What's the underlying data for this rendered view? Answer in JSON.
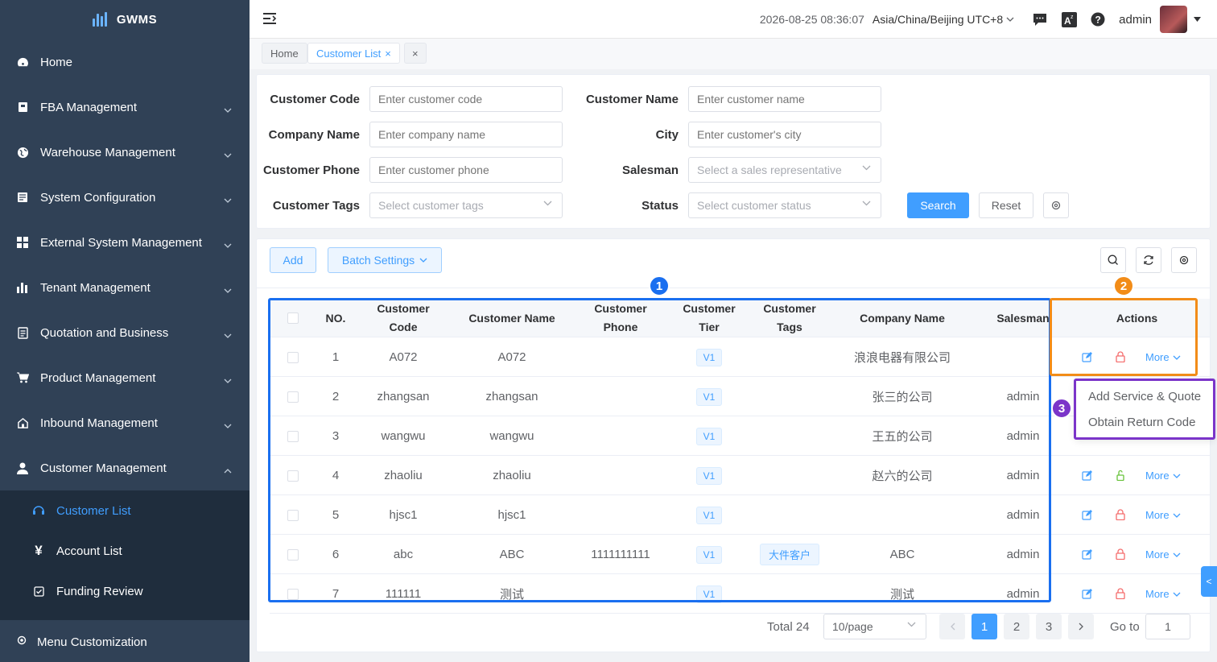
{
  "brand": {
    "name": "GWMS"
  },
  "sidebar": {
    "items": [
      {
        "label": "Home",
        "icon": "dashboard-icon"
      },
      {
        "label": "FBA Management",
        "icon": "box-icon"
      },
      {
        "label": "Warehouse Management",
        "icon": "globe-icon"
      },
      {
        "label": "System Configuration",
        "icon": "server-icon"
      },
      {
        "label": "External System Management",
        "icon": "grid-icon"
      },
      {
        "label": "Tenant Management",
        "icon": "bar-chart-icon"
      },
      {
        "label": "Quotation and Business",
        "icon": "document-icon"
      },
      {
        "label": "Product Management",
        "icon": "cart-icon"
      },
      {
        "label": "Inbound Management",
        "icon": "home-icon"
      },
      {
        "label": "Customer Management",
        "icon": "user-icon"
      }
    ],
    "sub_items": [
      {
        "label": "Customer List",
        "icon": "headset-icon",
        "active": true
      },
      {
        "label": "Account List",
        "icon": "yen-icon"
      },
      {
        "label": "Funding Review",
        "icon": "check-square-icon"
      }
    ],
    "menu_customization": "Menu Customization"
  },
  "header": {
    "datetime": "2026-08-25 08:36:07",
    "timezone": "Asia/China/Beijing UTC+8",
    "user": "admin"
  },
  "tabs": [
    {
      "label": "Home"
    },
    {
      "label": "Customer List",
      "close": "×"
    },
    {
      "label": "×"
    }
  ],
  "filters": {
    "customer_code": {
      "label": "Customer Code",
      "placeholder": "Enter customer code"
    },
    "customer_name": {
      "label": "Customer Name",
      "placeholder": "Enter customer name"
    },
    "company_name": {
      "label": "Company Name",
      "placeholder": "Enter company name"
    },
    "city": {
      "label": "City",
      "placeholder": "Enter customer's city"
    },
    "customer_phone": {
      "label": "Customer Phone",
      "placeholder": "Enter customer phone"
    },
    "salesman": {
      "label": "Salesman",
      "placeholder": "Select a sales representative"
    },
    "customer_tags": {
      "label": "Customer Tags",
      "placeholder": "Select customer tags"
    },
    "status": {
      "label": "Status",
      "placeholder": "Select customer status"
    },
    "search_label": "Search",
    "reset_label": "Reset"
  },
  "toolbar": {
    "add_label": "Add",
    "batch_label": "Batch Settings"
  },
  "table": {
    "headers": {
      "no": "NO.",
      "code_1": "Customer",
      "code_2": "Code",
      "name": "Customer Name",
      "phone_1": "Customer",
      "phone_2": "Phone",
      "tier_1": "Customer",
      "tier_2": "Tier",
      "tags_1": "Customer",
      "tags_2": "Tags",
      "company": "Company Name",
      "salesman": "Salesman",
      "actions": "Actions"
    },
    "more_label": "More",
    "rows": [
      {
        "no": "1",
        "code": "A072",
        "name": "A072",
        "phone": "",
        "tier": "V1",
        "tags": "",
        "company": "浪浪电器有限公司",
        "salesman": ""
      },
      {
        "no": "2",
        "code": "zhangsan",
        "name": "zhangsan",
        "phone": "",
        "tier": "V1",
        "tags": "",
        "company": "张三的公司",
        "salesman": "admin"
      },
      {
        "no": "3",
        "code": "wangwu",
        "name": "wangwu",
        "phone": "",
        "tier": "V1",
        "tags": "",
        "company": "王五的公司",
        "salesman": "admin"
      },
      {
        "no": "4",
        "code": "zhaoliu",
        "name": "zhaoliu",
        "phone": "",
        "tier": "V1",
        "tags": "",
        "company": "赵六的公司",
        "salesman": "admin"
      },
      {
        "no": "5",
        "code": "hjsc1",
        "name": "hjsc1",
        "phone": "",
        "tier": "V1",
        "tags": "",
        "company": "",
        "salesman": "admin"
      },
      {
        "no": "6",
        "code": "abc",
        "name": "ABC",
        "phone": "1111111111",
        "tier": "V1",
        "tags": "大件客户",
        "company": "ABC",
        "salesman": "admin"
      },
      {
        "no": "7",
        "code": "111111",
        "name": "测试",
        "phone": "",
        "tier": "V1",
        "tags": "",
        "company": "测试",
        "salesman": "admin"
      }
    ]
  },
  "dropdown": {
    "items": [
      "Add Service & Quote",
      "Obtain Return Code"
    ]
  },
  "annotations": [
    {
      "num": "1",
      "color": "#1a6ff0"
    },
    {
      "num": "2",
      "color": "#f28c18"
    },
    {
      "num": "3",
      "color": "#7b35c9"
    }
  ],
  "pagination": {
    "total": "Total 24",
    "page_size": "10/page",
    "pages": [
      "1",
      "2",
      "3"
    ],
    "goto_label": "Go to",
    "goto_value": "1"
  },
  "side_tab": "<",
  "colors": {
    "primary": "#409eff",
    "sidebar": "#304156",
    "submenu": "#1f2d3d",
    "unlock": "#67c23a",
    "lock": "#f56c6c"
  }
}
